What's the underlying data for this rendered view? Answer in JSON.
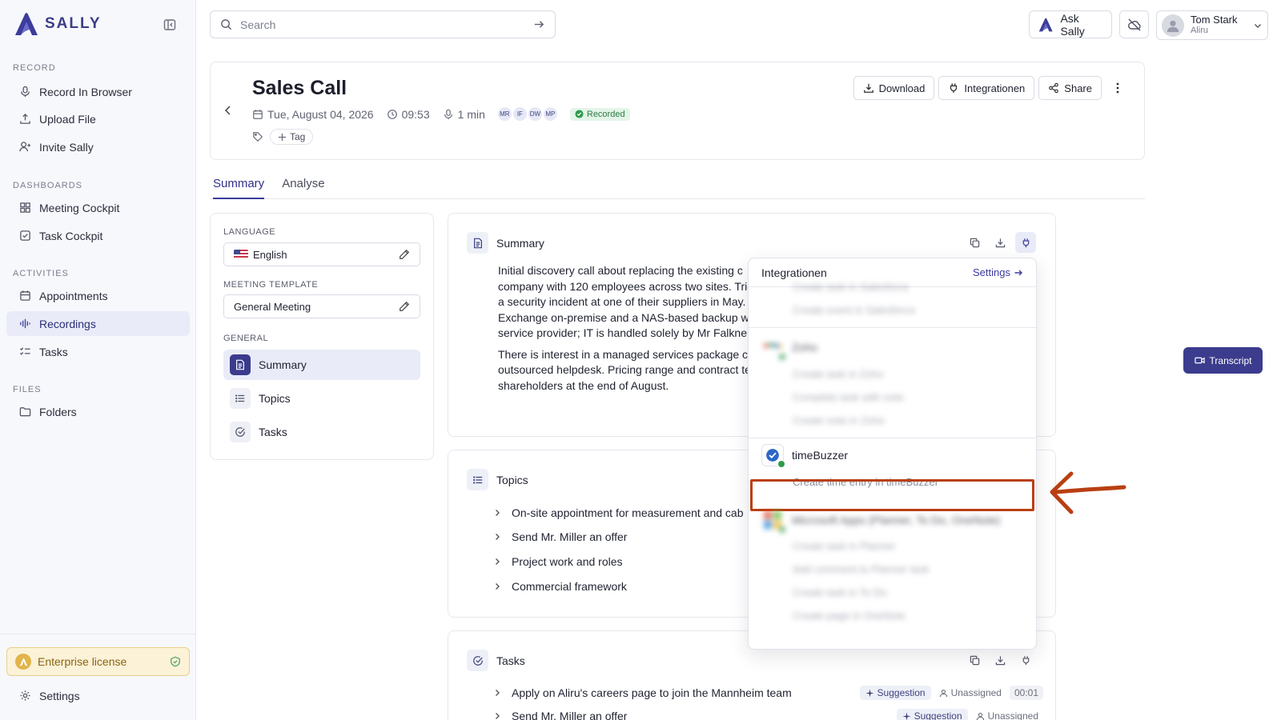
{
  "brand": {
    "name": "SALLY"
  },
  "sidebar": {
    "sections": [
      {
        "label": "RECORD",
        "items": [
          {
            "label": "Record In Browser",
            "icon": "mic-icon"
          },
          {
            "label": "Upload File",
            "icon": "upload-icon"
          },
          {
            "label": "Invite Sally",
            "icon": "user-plus-icon"
          }
        ]
      },
      {
        "label": "DASHBOARDS",
        "items": [
          {
            "label": "Meeting Cockpit",
            "icon": "grid-icon"
          },
          {
            "label": "Task Cockpit",
            "icon": "checkbox-icon"
          }
        ]
      },
      {
        "label": "ACTIVITIES",
        "items": [
          {
            "label": "Appointments",
            "icon": "calendar-icon"
          },
          {
            "label": "Recordings",
            "icon": "waveform-icon",
            "active": true
          },
          {
            "label": "Tasks",
            "icon": "list-check-icon"
          }
        ]
      },
      {
        "label": "FILES",
        "items": [
          {
            "label": "Folders",
            "icon": "folder-icon"
          }
        ]
      }
    ],
    "license": "Enterprise license",
    "settings": "Settings"
  },
  "topbar": {
    "search_placeholder": "Search",
    "ask_label": "Ask Sally",
    "user": {
      "name": "Tom Stark",
      "org": "Aliru"
    }
  },
  "meeting": {
    "title": "Sales Call",
    "date": "Tue, August 04, 2026",
    "time": "09:53",
    "duration": "1 min",
    "participants": [
      "MR",
      "IF",
      "DW",
      "MP"
    ],
    "status": "Recorded",
    "tag_button": "Tag",
    "actions": {
      "download": "Download",
      "integrations": "Integrationen",
      "share": "Share"
    }
  },
  "tabs": [
    {
      "label": "Summary",
      "active": true
    },
    {
      "label": "Analyse"
    }
  ],
  "left_panel": {
    "language_label": "LANGUAGE",
    "language_value": "English",
    "template_label": "MEETING TEMPLATE",
    "template_value": "General Meeting",
    "general_label": "GENERAL",
    "nav": [
      {
        "label": "Summary"
      },
      {
        "label": "Topics"
      },
      {
        "label": "Tasks"
      }
    ]
  },
  "summary_card": {
    "title": "Summary",
    "lines_p1": [
      "Initial discovery call about replacing the existing c",
      "company with 120 employees across two sites. Trig",
      "a security incident at one of their suppliers in May. T",
      "Exchange on-premise and a NAS-based backup wit",
      "service provider; IT is handled solely by Mr Falkner a"
    ],
    "lines_p2": [
      "There is interest in a managed services package co",
      "outsourced helpdesk. Pricing range and contract te",
      "shareholders at the end of August."
    ]
  },
  "topics_card": {
    "title": "Topics",
    "items": [
      "On-site appointment for measurement and cab",
      "Send Mr. Miller an offer",
      "Project work and roles",
      "Commercial framework"
    ]
  },
  "tasks_card": {
    "title": "Tasks",
    "items": [
      {
        "text": "Apply on Aliru's careers page to join the Mannheim team",
        "badge": "Suggestion",
        "assignee": "Unassigned",
        "duration": "00:01"
      },
      {
        "text": "Send Mr. Miller an offer",
        "badge": "Suggestion",
        "assignee": "Unassigned"
      }
    ]
  },
  "transcript_button": "Transcript",
  "integrations_dropdown": {
    "title": "Integrationen",
    "settings_link": "Settings",
    "groups": [
      {
        "name": "",
        "actions": [
          "Create task in Salesforce",
          "Create event in Salesforce"
        ]
      },
      {
        "name": "Zoho",
        "actions": [
          "Create task in Zoho",
          "Complete task with note",
          "Create note in Zoho"
        ]
      },
      {
        "name": "timeBuzzer",
        "actions": [
          "Create time entry in timeBuzzer"
        ]
      },
      {
        "name": "Microsoft Apps (Planner, To Do, OneNote)",
        "actions": [
          "Create task in Planner",
          "Add comment to Planner task",
          "Create task in To Do",
          "Create page in OneNote"
        ]
      }
    ]
  },
  "colors": {
    "brand": "#3a3b9a",
    "highlight": "#b93f12",
    "active_bg": "#e9ebf8"
  }
}
